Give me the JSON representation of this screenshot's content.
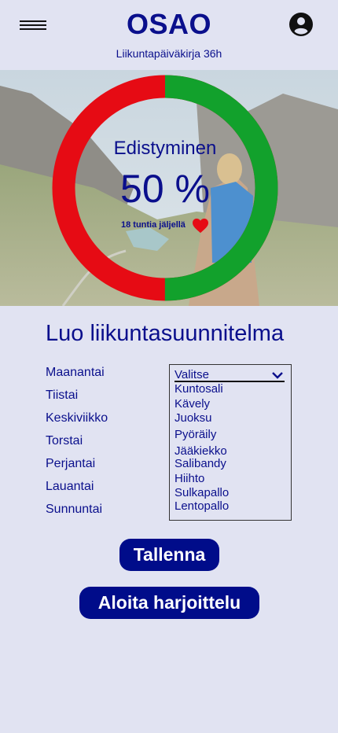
{
  "header": {
    "brand": "OSAO",
    "subtitle": "Liikuntapäiväkirja 36h"
  },
  "progress": {
    "title": "Edistyminen",
    "value_text": "50 %",
    "value": 0.5,
    "remaining": "18 tuntia jäljellä",
    "colors": {
      "done": "#12a12c",
      "left": "#e60b14"
    }
  },
  "plan": {
    "title": "Luo liikuntasuunnitelma",
    "days": [
      "Maanantai",
      "Tiistai",
      "Keskiviikko",
      "Torstai",
      "Perjantai",
      "Lauantai",
      "Sunnuntai"
    ],
    "select": {
      "selected": "Valitse",
      "options": [
        "Kuntosali",
        "Kävely",
        "Juoksu",
        "Pyöräily",
        "Jääkiekko",
        "Salibandy",
        "Hiihto",
        "Sulkapallo",
        "Lentopallo"
      ]
    }
  },
  "buttons": {
    "save": "Tallenna",
    "start": "Aloita harjoittelu"
  },
  "icons": [
    "menu-icon",
    "account-icon",
    "heart-icon",
    "chevron-down-icon"
  ]
}
